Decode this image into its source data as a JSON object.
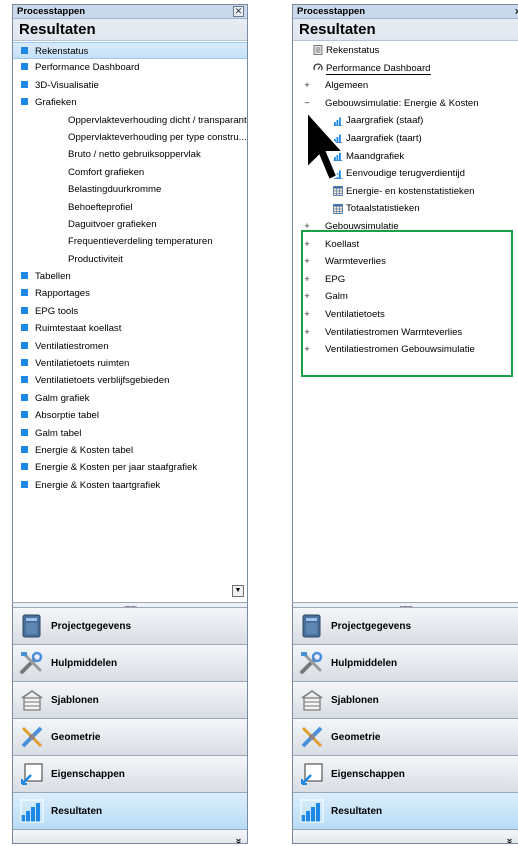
{
  "left": {
    "panel_title": "Processtappen",
    "section_title": "Resultaten",
    "items": [
      {
        "label": "Rekenstatus",
        "level": 0,
        "selected": true
      },
      {
        "label": "Performance Dashboard",
        "level": 0
      },
      {
        "label": "3D-Visualisatie",
        "level": 0
      },
      {
        "label": "Grafieken",
        "level": 0
      },
      {
        "label": "Oppervlakteverhouding dicht / transparant",
        "level": 1
      },
      {
        "label": "Oppervlakteverhouding per type constru...",
        "level": 1
      },
      {
        "label": "Bruto / netto gebruiksoppervlak",
        "level": 1
      },
      {
        "label": "Comfort grafieken",
        "level": 1
      },
      {
        "label": "Belastingduurkromme",
        "level": 1
      },
      {
        "label": "Behoefteprofiel",
        "level": 1
      },
      {
        "label": "Daguitvoer grafieken",
        "level": 1
      },
      {
        "label": "Frequentieverdeling temperaturen",
        "level": 1
      },
      {
        "label": "Productiviteit",
        "level": 1
      },
      {
        "label": "Tabellen",
        "level": 0
      },
      {
        "label": "Rapportages",
        "level": 0
      },
      {
        "label": "EPG tools",
        "level": 0
      },
      {
        "label": "Ruimtestaat koellast",
        "level": 0
      },
      {
        "label": "Ventilatiestromen",
        "level": 0
      },
      {
        "label": "Ventilatietoets ruimten",
        "level": 0
      },
      {
        "label": "Ventilatietoets verblijfsgebieden",
        "level": 0
      },
      {
        "label": "Galm grafiek",
        "level": 0
      },
      {
        "label": "Absorptie tabel",
        "level": 0
      },
      {
        "label": "Galm tabel",
        "level": 0
      },
      {
        "label": "Energie & Kosten tabel",
        "level": 0
      },
      {
        "label": "Energie & Kosten per jaar staafgrafiek",
        "level": 0
      },
      {
        "label": "Energie & Kosten taartgrafiek",
        "level": 0
      }
    ]
  },
  "right": {
    "panel_title": "Processtappen",
    "section_title": "Resultaten",
    "items": [
      {
        "label": "Rekenstatus",
        "level": 1,
        "expander": "",
        "icon": "table-icon"
      },
      {
        "label": "Performance Dashboard",
        "level": 1,
        "expander": "",
        "icon": "dashboard-icon"
      },
      {
        "label": "Algemeen",
        "level": 0,
        "expander": "+",
        "icon": ""
      },
      {
        "label": "Gebouwsimulatie: Energie & Kosten",
        "level": 0,
        "expander": "−",
        "icon": ""
      },
      {
        "label": "Jaargrafiek (staaf)",
        "level": 2,
        "expander": "",
        "icon": "bar-chart-icon"
      },
      {
        "label": "Jaargrafiek (taart)",
        "level": 2,
        "expander": "",
        "icon": "bar-chart-icon"
      },
      {
        "label": "Maandgrafiek",
        "level": 2,
        "expander": "",
        "icon": "bar-chart-icon"
      },
      {
        "label": "Eenvoudige terugverdientijd",
        "level": 2,
        "expander": "",
        "icon": "bar-chart-icon"
      },
      {
        "label": "Energie- en kostenstatistieken",
        "level": 2,
        "expander": "",
        "icon": "grid-icon"
      },
      {
        "label": "Totaalstatistieken",
        "level": 2,
        "expander": "",
        "icon": "grid-icon"
      },
      {
        "label": "Gebouwsimulatie",
        "level": 0,
        "expander": "+",
        "icon": ""
      },
      {
        "label": "Koellast",
        "level": 0,
        "expander": "+",
        "icon": ""
      },
      {
        "label": "Warmteverlies",
        "level": 0,
        "expander": "+",
        "icon": ""
      },
      {
        "label": "EPG",
        "level": 0,
        "expander": "+",
        "icon": ""
      },
      {
        "label": "Galm",
        "level": 0,
        "expander": "+",
        "icon": ""
      },
      {
        "label": "Ventilatietoets",
        "level": 0,
        "expander": "+",
        "icon": ""
      },
      {
        "label": "Ventilatiestromen Warmteverlies",
        "level": 0,
        "expander": "+",
        "icon": ""
      },
      {
        "label": "Ventilatiestromen Gebouwsimulatie",
        "level": 0,
        "expander": "+",
        "icon": ""
      }
    ]
  },
  "nav": [
    {
      "label": "Projectgegevens",
      "icon": "project-data-icon"
    },
    {
      "label": "Hulpmiddelen",
      "icon": "tools-icon"
    },
    {
      "label": "Sjablonen",
      "icon": "templates-icon"
    },
    {
      "label": "Geometrie",
      "icon": "geometry-icon"
    },
    {
      "label": "Eigenschappen",
      "icon": "properties-icon"
    },
    {
      "label": "Resultaten",
      "icon": "results-icon",
      "active": true
    }
  ],
  "colors": {
    "accent": "#1e88e5",
    "highlight_box": "#1aa04a"
  }
}
